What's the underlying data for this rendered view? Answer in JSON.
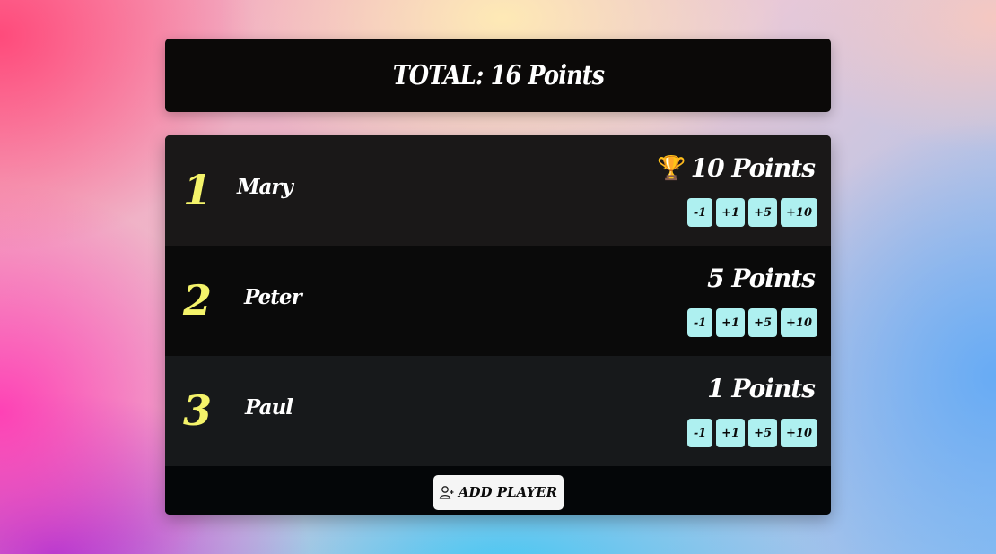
{
  "header": {
    "total_label": "TOTAL: 16 Points"
  },
  "players": [
    {
      "rank": "1",
      "name": "Mary",
      "score_label": "10 Points",
      "leader_icon": "🏆",
      "buttons": [
        "-1",
        "+1",
        "+5",
        "+10"
      ]
    },
    {
      "rank": "2",
      "name": "Peter",
      "score_label": "5 Points",
      "leader_icon": "",
      "buttons": [
        "-1",
        "+1",
        "+5",
        "+10"
      ]
    },
    {
      "rank": "3",
      "name": "Paul",
      "score_label": "1 Points",
      "leader_icon": "",
      "buttons": [
        "-1",
        "+1",
        "+5",
        "+10"
      ]
    }
  ],
  "footer": {
    "add_player_label": "ADD PLAYER",
    "add_player_icon": "user-plus-icon"
  },
  "colors": {
    "rank": "#f4f36a",
    "score_button": "#aef0f0",
    "card_background": "#0b0908"
  }
}
